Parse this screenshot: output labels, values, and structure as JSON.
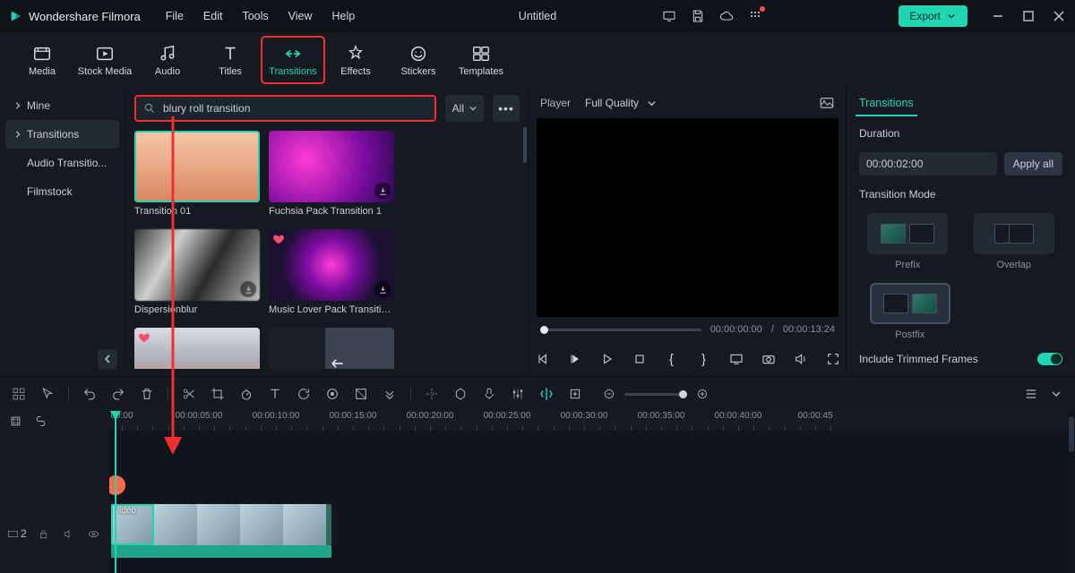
{
  "app": {
    "name": "Wondershare Filmora",
    "doc_title": "Untitled"
  },
  "menubar": [
    "File",
    "Edit",
    "Tools",
    "View",
    "Help"
  ],
  "export_label": "Export",
  "categories": [
    {
      "id": "media",
      "label": "Media"
    },
    {
      "id": "stock",
      "label": "Stock Media"
    },
    {
      "id": "audio",
      "label": "Audio"
    },
    {
      "id": "titles",
      "label": "Titles"
    },
    {
      "id": "transitions",
      "label": "Transitions"
    },
    {
      "id": "effects",
      "label": "Effects"
    },
    {
      "id": "stickers",
      "label": "Stickers"
    },
    {
      "id": "templates",
      "label": "Templates"
    }
  ],
  "category_selected": "transitions",
  "sidebar": {
    "items": [
      {
        "id": "mine",
        "label": "Mine",
        "expandable": true
      },
      {
        "id": "transitions",
        "label": "Transitions",
        "expandable": true,
        "selected": true
      },
      {
        "id": "audio-trans",
        "label": "Audio Transitio..."
      },
      {
        "id": "filmstock",
        "label": "Filmstock"
      }
    ]
  },
  "search": {
    "value": "blury roll transition",
    "filter_label": "All"
  },
  "cards": [
    {
      "id": "t01",
      "label": "Transition 01",
      "selected": true,
      "dl": false
    },
    {
      "id": "fuchsia",
      "label": "Fuchsia Pack Transition 1",
      "dl": true
    },
    {
      "id": "dispblur",
      "label": "Dispersionblur",
      "dl": true
    },
    {
      "id": "musiclover",
      "label": "Music Lover Pack Transition ...",
      "dl": true,
      "heart": true
    },
    {
      "id": "c5",
      "label": "",
      "dl": false,
      "heart": true
    },
    {
      "id": "c6",
      "label": "",
      "dl": false
    }
  ],
  "player": {
    "label": "Player",
    "quality_label": "Full Quality",
    "current_tc": "00:00:00:00",
    "sep": "/",
    "total_tc": "00:00:13:24"
  },
  "inspector": {
    "tab": "Transitions",
    "duration_label": "Duration",
    "duration_value": "00:00:02:00",
    "apply_all": "Apply all",
    "mode_label": "Transition Mode",
    "modes": [
      {
        "id": "prefix",
        "label": "Prefix"
      },
      {
        "id": "overlap",
        "label": "Overlap"
      },
      {
        "id": "postfix",
        "label": "Postfix",
        "selected": true
      }
    ],
    "trimmed_label": "Include Trimmed Frames"
  },
  "timeline": {
    "ruler": [
      "00:00",
      "00:00:05:00",
      "00:00:10:00",
      "00:00:15:00",
      "00:00:20:00",
      "00:00:25:00",
      "00:00:30:00",
      "00:00:35:00",
      "00:00:40:00",
      "00:00:45"
    ],
    "track_badge": "2",
    "clip_label": "video"
  }
}
